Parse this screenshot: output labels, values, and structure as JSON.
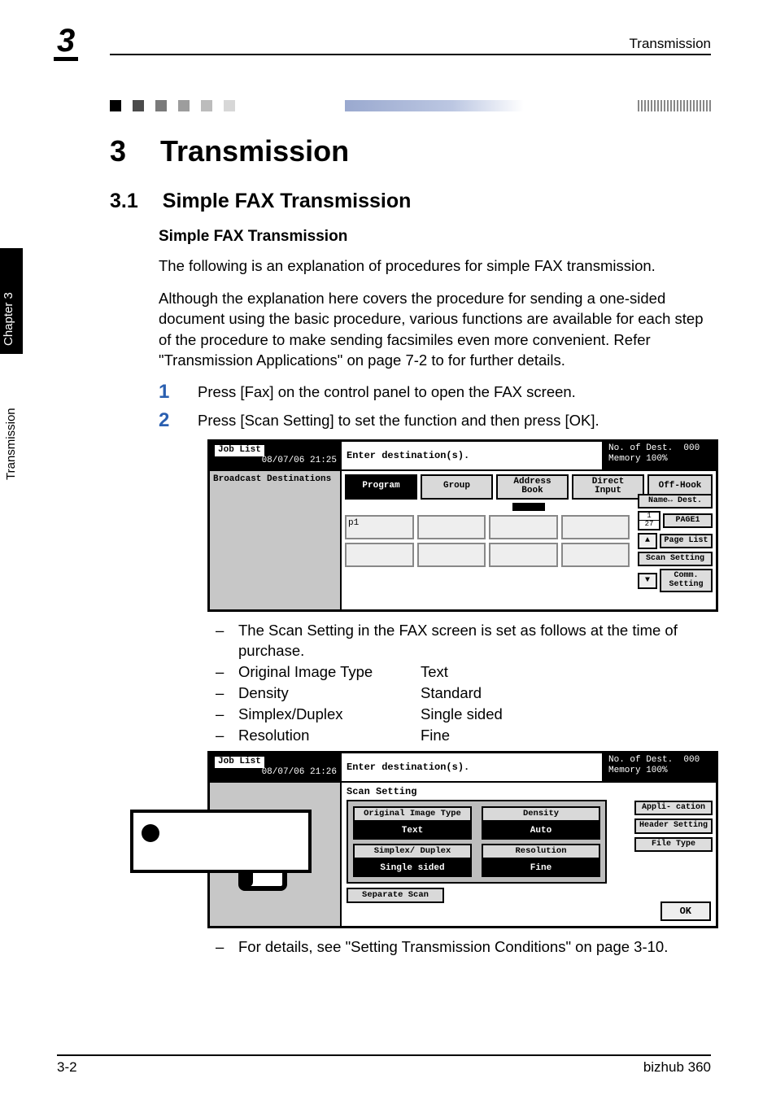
{
  "running_header": "Transmission",
  "chapter_corner_num": "3",
  "side_tab": {
    "chapter_label": "Chapter 3",
    "book_label": "Transmission"
  },
  "chapter_title": {
    "num": "3",
    "text": "Transmission"
  },
  "section": {
    "num": "3.1",
    "text": "Simple FAX Transmission"
  },
  "subsection": "Simple FAX Transmission",
  "para1": "The following is an explanation of procedures for simple FAX transmission.",
  "para2": "Although the explanation here covers the procedure for sending a one-sided document using the basic procedure, various functions are available for each step of the procedure to make sending facsimiles even more convenient. Refer \"Transmission Applications\" on page 7-2 to for further details.",
  "steps": [
    {
      "num": "1",
      "text": "Press [Fax] on the control panel to open the FAX screen."
    },
    {
      "num": "2",
      "text": "Press [Scan Setting] to set the function and then press [OK]."
    }
  ],
  "lcd1": {
    "job_list": "Job List",
    "datetime": "08/07/06 21:25",
    "prompt": "Enter destination(s).",
    "dest_label": "No. of Dest.",
    "dest_count": "000",
    "memory": "Memory 100%",
    "sidebar": "Broadcast Destinations",
    "tabs": [
      "Program",
      "Group",
      "Address Book",
      "Direct Input"
    ],
    "offhook": "Off-Hook",
    "entry_p1": "p1",
    "page_counter_top": "1",
    "page_counter_bottom": "27",
    "r_buttons": [
      "Name↔ Dest.",
      "PAGE1",
      "Page List",
      "Scan Setting",
      "Comm. Setting"
    ]
  },
  "note_intro": "The Scan Setting in the FAX screen is set as follows at the time of purchase.",
  "specs": [
    {
      "label": "Original Image Type",
      "value": "Text"
    },
    {
      "label": "Density",
      "value": "Standard"
    },
    {
      "label": "Simplex/Duplex",
      "value": "Single sided"
    },
    {
      "label": "Resolution",
      "value": "Fine"
    }
  ],
  "lcd2": {
    "job_list": "Job List",
    "datetime": "08/07/06 21:26",
    "prompt": "Enter destination(s).",
    "dest_label": "No. of Dest.",
    "dest_count": "000",
    "memory": "Memory 100%",
    "panel_title": "Scan Setting",
    "settings": {
      "orig_label": "Original Image Type",
      "orig_val": "Text",
      "density_label": "Density",
      "density_val": "Auto",
      "duplex_label": "Simplex/ Duplex",
      "duplex_val": "Single sided",
      "res_label": "Resolution",
      "res_val": "Fine",
      "separate": "Separate Scan"
    },
    "r_buttons": [
      "Appli- cation",
      "Header Setting",
      "File Type"
    ],
    "ok": "OK"
  },
  "footnote": "For details, see \"Setting Transmission Conditions\" on page 3-10.",
  "footer": {
    "left": "3-2",
    "right": "bizhub 360"
  },
  "chart_data": null
}
